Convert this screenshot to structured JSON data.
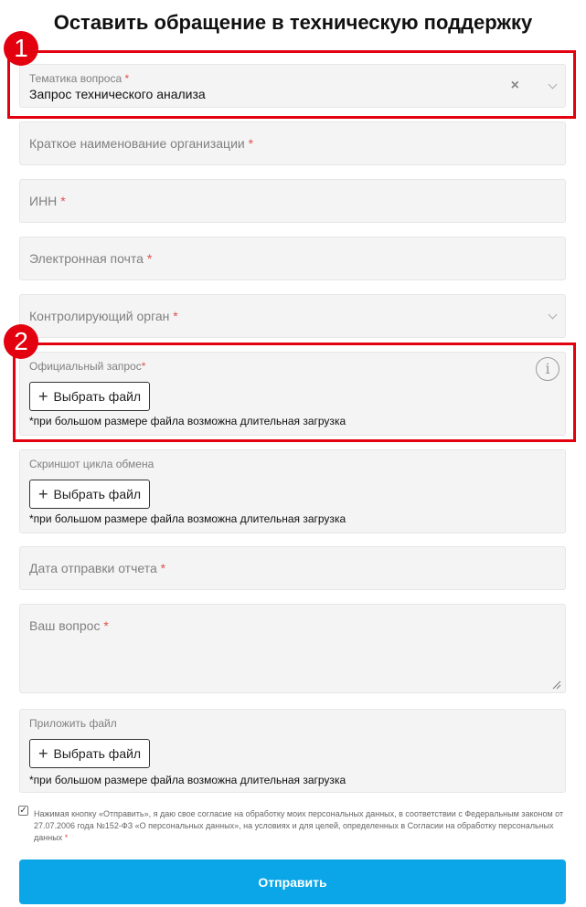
{
  "title": "Оставить обращение в техническую поддержку",
  "required_mark": "*",
  "topic": {
    "label": "Тематика вопроса",
    "value": "Запрос технического анализа",
    "clear_glyph": "×"
  },
  "org_name": {
    "placeholder": "Краткое наименование организации"
  },
  "inn": {
    "placeholder": "ИНН"
  },
  "email": {
    "placeholder": "Электронная почта"
  },
  "authority": {
    "placeholder": "Контролирующий орган"
  },
  "official_request": {
    "label": "Официальный запрос",
    "button": "Выбрать файл",
    "note": "*при большом размере файла возможна длительная загрузка",
    "info_glyph": "i"
  },
  "screenshot": {
    "label": "Скриншот цикла обмена",
    "button": "Выбрать файл",
    "note": "*при большом размере файла возможна длительная загрузка"
  },
  "report_date": {
    "placeholder": "Дата отправки отчета"
  },
  "question": {
    "placeholder": "Ваш вопрос"
  },
  "attach": {
    "label": "Приложить файл",
    "button": "Выбрать файл",
    "note": "*при большом размере файла возможна длительная загрузка"
  },
  "consent": {
    "checked": true,
    "text": "Нажимая кнопку «Отправить», я даю свое согласие на обработку моих персональных данных, в соответствии с Федеральным законом от 27.07.2006 года №152-ФЗ «О персональных данных», на условиях и для целей, определенных в Согласии на обработку персональных данных"
  },
  "submit": "Отправить",
  "annotations": [
    {
      "number": "1"
    },
    {
      "number": "2"
    }
  ],
  "colors": {
    "accent": "#0aa6e8",
    "highlight": "#e3000f",
    "required": "#e2504c",
    "field_bg": "#f4f4f4"
  }
}
